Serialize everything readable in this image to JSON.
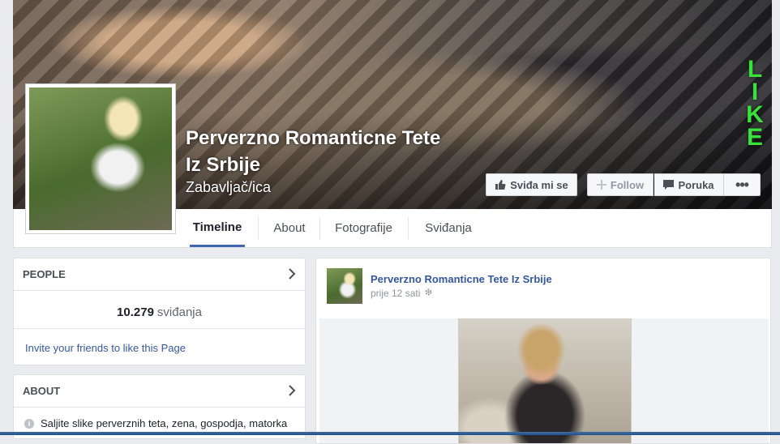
{
  "page": {
    "name": "Perverzno Romanticne Tete Iz Srbije",
    "name_line1": "Perverzno Romanticne Tete",
    "name_line2": "Iz Srbije",
    "category": "Zabavljač/ica",
    "cover_text": [
      "L",
      "I",
      "K",
      "E"
    ]
  },
  "actions": {
    "like_label": "Sviđa mi se",
    "follow_label": "Follow",
    "message_label": "Poruka",
    "more_label": "•••"
  },
  "nav": {
    "tabs": [
      {
        "label": "Timeline"
      },
      {
        "label": "About"
      },
      {
        "label": "Fotografije"
      },
      {
        "label": "Sviđanja"
      }
    ]
  },
  "people": {
    "title": "PEOPLE",
    "likes_count": "10.279",
    "likes_label": "sviđanja",
    "invite_text": "Invite your friends to like this Page"
  },
  "about": {
    "title": "ABOUT",
    "text": "Saljite slike perverznih teta, zena, gospodja, matorka"
  },
  "post": {
    "author": "Perverzno Romanticne Tete Iz Srbije",
    "time": "prije 12 sati"
  },
  "colors": {
    "link": "#365899",
    "accent": "#4267b2",
    "cover_like": "#39e13d"
  }
}
